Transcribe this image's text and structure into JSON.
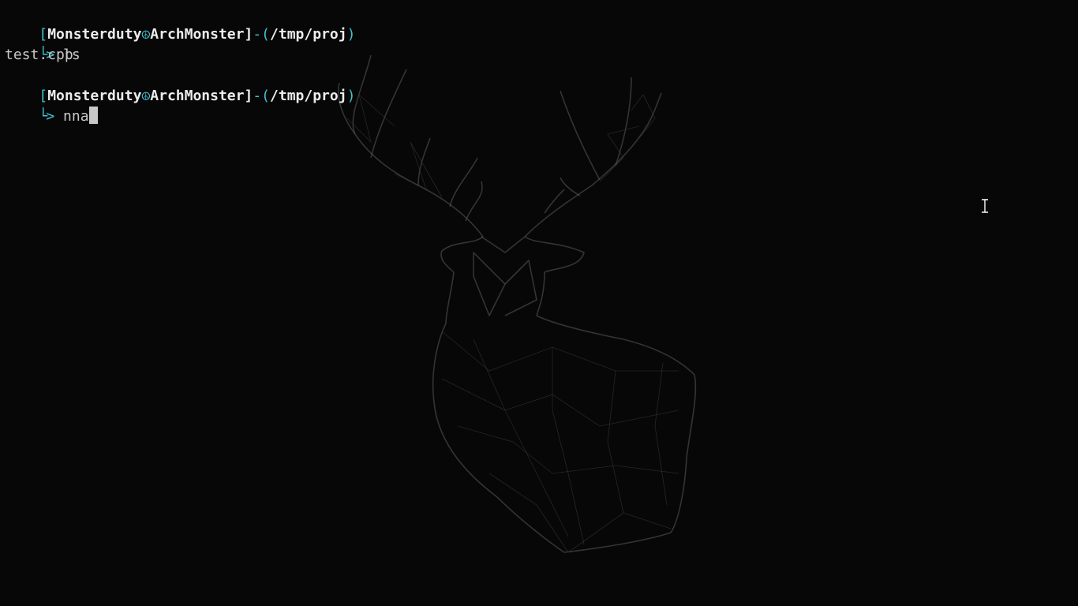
{
  "prompt1": {
    "open_bracket": "[",
    "user": "Monsterduty",
    "separator": "☮",
    "host": "ArchMonster",
    "close_bracket": "]",
    "dash": "-",
    "open_paren": "(",
    "path": "/tmp/proj",
    "close_paren": ")",
    "arrow": "> ",
    "command": "ls"
  },
  "output1": "test.cpp",
  "prompt2": {
    "open_bracket": "[",
    "user": "Monsterduty",
    "separator": "☮",
    "host": "ArchMonster",
    "close_bracket": "]",
    "dash": "-",
    "open_paren": "(",
    "path": "/tmp/proj",
    "close_paren": ")",
    "arrow": "> ",
    "command": "nna"
  },
  "colors": {
    "background": "#070707",
    "accent_cyan": "#3ec5d4",
    "text": "#c8c8c8",
    "bold_text": "#ececec"
  },
  "icons": {
    "background_art": "deer-head-wireframe",
    "mouse_pointer": "text-ibeam-cursor"
  }
}
